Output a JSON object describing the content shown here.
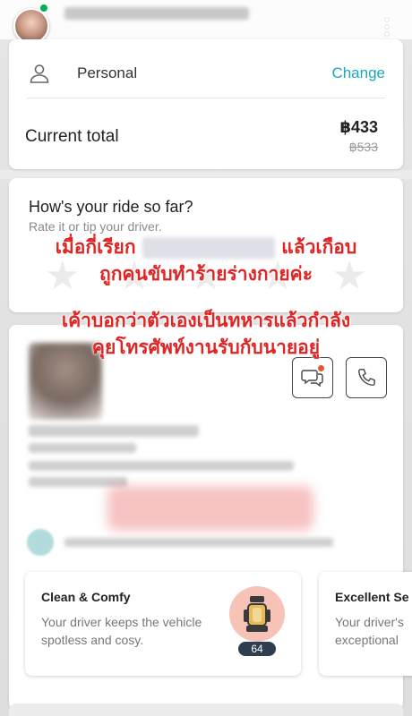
{
  "colors": {
    "accent": "#19a8bd",
    "overlay_text": "#e02424",
    "verified_badge": "#00b14f"
  },
  "header": {
    "avatar_icon": "avatar-photo",
    "menu_icon": "kebab-menu-icon"
  },
  "payment": {
    "method_icon": "person-icon",
    "method_label": "Personal",
    "change_label": "Change",
    "total_label": "Current total",
    "total_value": "฿433",
    "original_value": "฿533"
  },
  "rating": {
    "title": "How's your ride so far?",
    "subtitle": "Rate it or tip your driver.",
    "star_count": 5
  },
  "overlay": {
    "line1_prefix": "เมื่อกี่เรียก",
    "line1_suffix": "แล้วเกือบ",
    "line2": "ถูกคนขับทำร้ายร่างกายค่ะ",
    "line3": "เค้าบอกว่าตัวเองเป็นทหารแล้วกำลัง",
    "line4": "คุยโทรศัพท์งานรับกับนายอยู่"
  },
  "driver": {
    "chat_icon": "chat-icon",
    "phone_icon": "phone-icon"
  },
  "compliments": [
    {
      "title": "Clean & Comfy",
      "description": "Your driver keeps the vehicle spotless and cosy.",
      "count": "64",
      "icon": "car-seat-icon"
    },
    {
      "title": "Excellent Se",
      "description": "Your driver's exceptional"
    }
  ]
}
